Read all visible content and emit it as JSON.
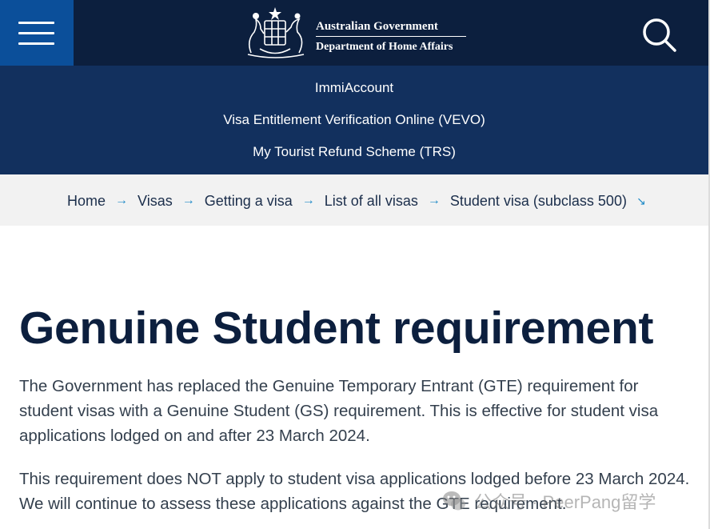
{
  "header": {
    "logo_line1": "Australian Government",
    "logo_line2": "Department of Home Affairs"
  },
  "quick_links": [
    "ImmiAccount",
    "Visa Entitlement Verification Online (VEVO)",
    "My Tourist Refund Scheme (TRS)"
  ],
  "breadcrumb": {
    "items": [
      "Home",
      "Visas",
      "Getting a visa",
      "List of all visas",
      "Student visa (subclass 500)"
    ],
    "separator": "→",
    "end_icon": "↘"
  },
  "page": {
    "title": "Genuine Student requirement",
    "paragraph1": "The Government has replaced the Genuine Temporary Entrant (GTE) requirement for student visas with a Genuine Student (GS) requirement. This is effective for student visa applications lodged on and after 23 March 2024.",
    "paragraph2": "This requirement does NOT apply to student visa applications lodged before 23 March 2024. We will continue to assess these applications against the GTE requirement."
  },
  "watermark": {
    "text": "公众号 · PeerPang留学",
    "icon": "wechat-icon"
  },
  "colors": {
    "header_bg": "#0c1f3e",
    "menu_bg": "#0b4f9a",
    "quicklinks_bg": "#12305e",
    "breadcrumb_bg": "#f2f2f2",
    "accent": "#1f8ac7"
  }
}
